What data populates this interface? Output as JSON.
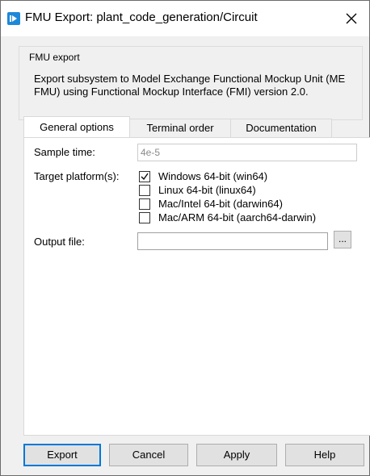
{
  "window": {
    "title": "FMU Export: plant_code_generation/Circuit",
    "close_glyph": "×"
  },
  "groupbox": {
    "title": "FMU export",
    "description": "Export subsystem to Model Exchange Functional Mockup Unit (ME FMU) using Functional Mockup Interface (FMI) version 2.0."
  },
  "tabs": [
    {
      "label": "General options",
      "active": true
    },
    {
      "label": "Terminal order",
      "active": false
    },
    {
      "label": "Documentation",
      "active": false
    }
  ],
  "general": {
    "sample_time_label": "Sample time:",
    "sample_time_value": "4e-5",
    "target_platforms_label": "Target platform(s):",
    "platforms": [
      {
        "label": "Windows 64-bit (win64)",
        "checked": true
      },
      {
        "label": "Linux 64-bit (linux64)",
        "checked": false
      },
      {
        "label": "Mac/Intel 64-bit (darwin64)",
        "checked": false
      },
      {
        "label": "Mac/ARM 64-bit (aarch64-darwin)",
        "checked": false
      }
    ],
    "output_file_label": "Output file:",
    "output_file_value": "",
    "browse_label": "..."
  },
  "buttons": {
    "export": "Export",
    "cancel": "Cancel",
    "apply": "Apply",
    "help": "Help"
  },
  "colors": {
    "accent": "#0078d7",
    "title_icon": "#1e88d8"
  },
  "icons": {
    "title": "fmu-export-icon",
    "close": "close-icon"
  }
}
